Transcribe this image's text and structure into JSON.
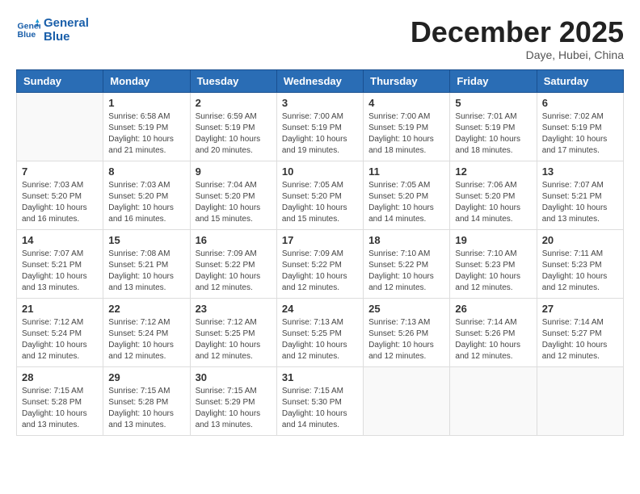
{
  "header": {
    "logo_line1": "General",
    "logo_line2": "Blue",
    "month_title": "December 2025",
    "location": "Daye, Hubei, China"
  },
  "weekdays": [
    "Sunday",
    "Monday",
    "Tuesday",
    "Wednesday",
    "Thursday",
    "Friday",
    "Saturday"
  ],
  "weeks": [
    [
      {
        "day": "",
        "info": ""
      },
      {
        "day": "1",
        "info": "Sunrise: 6:58 AM\nSunset: 5:19 PM\nDaylight: 10 hours\nand 21 minutes."
      },
      {
        "day": "2",
        "info": "Sunrise: 6:59 AM\nSunset: 5:19 PM\nDaylight: 10 hours\nand 20 minutes."
      },
      {
        "day": "3",
        "info": "Sunrise: 7:00 AM\nSunset: 5:19 PM\nDaylight: 10 hours\nand 19 minutes."
      },
      {
        "day": "4",
        "info": "Sunrise: 7:00 AM\nSunset: 5:19 PM\nDaylight: 10 hours\nand 18 minutes."
      },
      {
        "day": "5",
        "info": "Sunrise: 7:01 AM\nSunset: 5:19 PM\nDaylight: 10 hours\nand 18 minutes."
      },
      {
        "day": "6",
        "info": "Sunrise: 7:02 AM\nSunset: 5:19 PM\nDaylight: 10 hours\nand 17 minutes."
      }
    ],
    [
      {
        "day": "7",
        "info": "Sunrise: 7:03 AM\nSunset: 5:20 PM\nDaylight: 10 hours\nand 16 minutes."
      },
      {
        "day": "8",
        "info": "Sunrise: 7:03 AM\nSunset: 5:20 PM\nDaylight: 10 hours\nand 16 minutes."
      },
      {
        "day": "9",
        "info": "Sunrise: 7:04 AM\nSunset: 5:20 PM\nDaylight: 10 hours\nand 15 minutes."
      },
      {
        "day": "10",
        "info": "Sunrise: 7:05 AM\nSunset: 5:20 PM\nDaylight: 10 hours\nand 15 minutes."
      },
      {
        "day": "11",
        "info": "Sunrise: 7:05 AM\nSunset: 5:20 PM\nDaylight: 10 hours\nand 14 minutes."
      },
      {
        "day": "12",
        "info": "Sunrise: 7:06 AM\nSunset: 5:20 PM\nDaylight: 10 hours\nand 14 minutes."
      },
      {
        "day": "13",
        "info": "Sunrise: 7:07 AM\nSunset: 5:21 PM\nDaylight: 10 hours\nand 13 minutes."
      }
    ],
    [
      {
        "day": "14",
        "info": "Sunrise: 7:07 AM\nSunset: 5:21 PM\nDaylight: 10 hours\nand 13 minutes."
      },
      {
        "day": "15",
        "info": "Sunrise: 7:08 AM\nSunset: 5:21 PM\nDaylight: 10 hours\nand 13 minutes."
      },
      {
        "day": "16",
        "info": "Sunrise: 7:09 AM\nSunset: 5:22 PM\nDaylight: 10 hours\nand 12 minutes."
      },
      {
        "day": "17",
        "info": "Sunrise: 7:09 AM\nSunset: 5:22 PM\nDaylight: 10 hours\nand 12 minutes."
      },
      {
        "day": "18",
        "info": "Sunrise: 7:10 AM\nSunset: 5:22 PM\nDaylight: 10 hours\nand 12 minutes."
      },
      {
        "day": "19",
        "info": "Sunrise: 7:10 AM\nSunset: 5:23 PM\nDaylight: 10 hours\nand 12 minutes."
      },
      {
        "day": "20",
        "info": "Sunrise: 7:11 AM\nSunset: 5:23 PM\nDaylight: 10 hours\nand 12 minutes."
      }
    ],
    [
      {
        "day": "21",
        "info": "Sunrise: 7:12 AM\nSunset: 5:24 PM\nDaylight: 10 hours\nand 12 minutes."
      },
      {
        "day": "22",
        "info": "Sunrise: 7:12 AM\nSunset: 5:24 PM\nDaylight: 10 hours\nand 12 minutes."
      },
      {
        "day": "23",
        "info": "Sunrise: 7:12 AM\nSunset: 5:25 PM\nDaylight: 10 hours\nand 12 minutes."
      },
      {
        "day": "24",
        "info": "Sunrise: 7:13 AM\nSunset: 5:25 PM\nDaylight: 10 hours\nand 12 minutes."
      },
      {
        "day": "25",
        "info": "Sunrise: 7:13 AM\nSunset: 5:26 PM\nDaylight: 10 hours\nand 12 minutes."
      },
      {
        "day": "26",
        "info": "Sunrise: 7:14 AM\nSunset: 5:26 PM\nDaylight: 10 hours\nand 12 minutes."
      },
      {
        "day": "27",
        "info": "Sunrise: 7:14 AM\nSunset: 5:27 PM\nDaylight: 10 hours\nand 12 minutes."
      }
    ],
    [
      {
        "day": "28",
        "info": "Sunrise: 7:15 AM\nSunset: 5:28 PM\nDaylight: 10 hours\nand 13 minutes."
      },
      {
        "day": "29",
        "info": "Sunrise: 7:15 AM\nSunset: 5:28 PM\nDaylight: 10 hours\nand 13 minutes."
      },
      {
        "day": "30",
        "info": "Sunrise: 7:15 AM\nSunset: 5:29 PM\nDaylight: 10 hours\nand 13 minutes."
      },
      {
        "day": "31",
        "info": "Sunrise: 7:15 AM\nSunset: 5:30 PM\nDaylight: 10 hours\nand 14 minutes."
      },
      {
        "day": "",
        "info": ""
      },
      {
        "day": "",
        "info": ""
      },
      {
        "day": "",
        "info": ""
      }
    ]
  ]
}
